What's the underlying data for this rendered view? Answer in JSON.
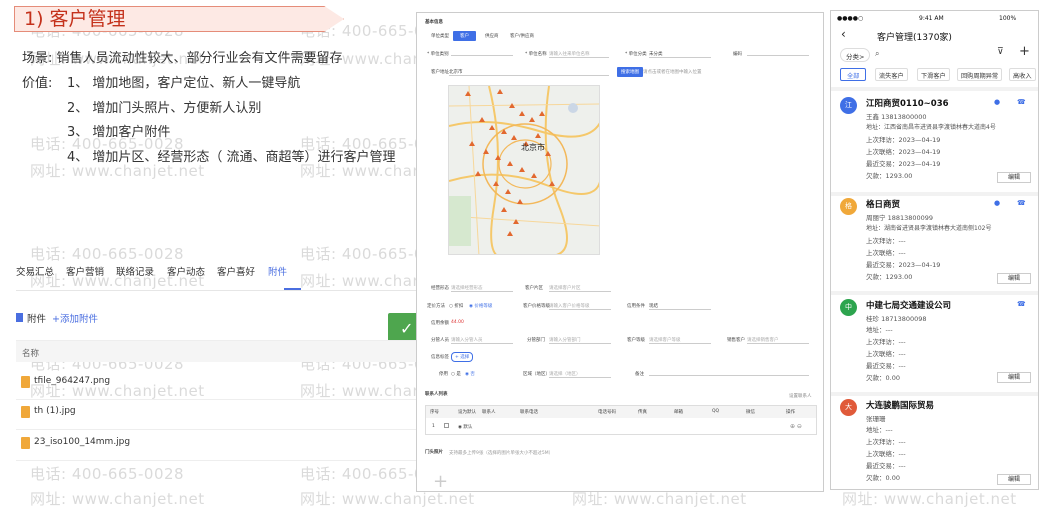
{
  "slide": {
    "title": "1) 客户管理",
    "scene": "场景:   销售人员流动性较大、部分行业会有文件需要留存",
    "value_label": "价值:",
    "values": [
      "1、 增加地图，客户定位、新人一键导航",
      "2、 增加门头照片、方便新人认别",
      "3、 增加客户附件",
      "4、 增加片区、经营形态（ 流通、商超等）进行客户管理"
    ]
  },
  "watermark": {
    "phone": "电话: 400-665-0028",
    "site": "网址: www.chanjet.net"
  },
  "detail": {
    "tabs": [
      "交易汇总",
      "客户营销",
      "联络记录",
      "客户动态",
      "客户喜好",
      "附件"
    ],
    "active_tab": "附件",
    "attach_title": "附件",
    "attach_add": "+添加附件",
    "col_name": "名称",
    "files": [
      "tfile_964247.png",
      "th (1).jpg",
      "23_iso100_14mm.jpg"
    ],
    "confirm_icon": "check-icon"
  },
  "form": {
    "header": "基本信息",
    "tabs": [
      "单位类型",
      "客户",
      "供应商",
      "客户/供应商"
    ],
    "fields": {
      "category": "* 单位类别",
      "name": "* 单位名称",
      "name_ph": "请输入往来单位名称",
      "cat_sub": "* 单位分类",
      "cat_sub_val": "未分类",
      "code": "编码",
      "address": "客户地址",
      "address_val": "北京市",
      "locate_btn": "搜索地图",
      "locate_hint": "请点击或者在地图中输入位置",
      "manager": "经营形态",
      "manager_ph": "请选择经营形态",
      "area": "客户片区",
      "area_ph": "请选择客户片区",
      "settle": "定价方法",
      "settle_opt1": "折扣",
      "settle_opt2": "价格等级",
      "price_level": "客户价格等级",
      "price_ph": "请输入客户价格等级",
      "credit": "信用条件",
      "credit_val": "现结",
      "credit_amt": "信用余额",
      "credit_amt_val": "44.00",
      "owner": "分管人员",
      "owner_ph": "请输入分管人员",
      "dept": "分管部门",
      "dept_ph": "请输入分管部门",
      "level": "客户等级",
      "level_ph": "请选择客户等级",
      "source": "销售客户",
      "source_ph": "请选择销售客户",
      "tag_label": "信息标签",
      "tag_add": "+ 选择",
      "yn_label": "停用",
      "yes": "是",
      "no": "否",
      "region": "区域（地区）",
      "region_ph": "请选择（地区）",
      "remark": "备注",
      "contacts": "联系人列表",
      "contacts_link": "设置联系人",
      "photo": "门头照片",
      "photo_hint": "支持最多上传9张（选择的图片单张大小不超过5M）"
    },
    "table_head": [
      "序号",
      "",
      "设为默认",
      "联系人",
      "联系电话",
      "电话号码",
      "传真",
      "邮箱",
      "QQ",
      "微信",
      "操作"
    ],
    "table_row": [
      "1",
      "",
      "默认"
    ],
    "map_city": "北京市"
  },
  "phone": {
    "time": "9:41 AM",
    "battery": "100%",
    "carrier": "●●●●○",
    "title": "客户管理(1370家)",
    "cat": "分类>",
    "chips": [
      "全部",
      "流失客户",
      "下滑客户",
      "回购周期异常",
      "高收入"
    ],
    "customers": [
      {
        "avatar": "江",
        "name": "江阳商贸0110~036",
        "contact": "王鑫 13813800000",
        "addr": "地址：江西省南昌市进贤县李渡镇林春大道南4号",
        "last_visit": "上次拜访：2023—04-19",
        "last_contact": "上次联络：2023—04-19",
        "last_deal": "最近交易：2023—04-19",
        "debt": "欠款：1293.00",
        "edit": "编辑",
        "color": "#3f6fe6"
      },
      {
        "avatar": "格",
        "name": "格日商贸",
        "contact": "周丽宁 18813800099",
        "addr": "地址：湖南省进贤县李渡镇林春大道南侧102号",
        "last_visit": "上次拜访：---",
        "last_contact": "上次联络：---",
        "last_deal": "最近交易：2023—04-19",
        "debt": "欠款：1293.00",
        "edit": "编辑",
        "color": "#f0a83a"
      },
      {
        "avatar": "中",
        "name": "中建七局交通建设公司",
        "contact": "桂珍 18713800098",
        "addr": "地址：---",
        "last_visit": "上次拜访：---",
        "last_contact": "上次联络：---",
        "last_deal": "最近交易：---",
        "debt": "欠款：0.00",
        "edit": "编辑",
        "color": "#2da44e"
      },
      {
        "avatar": "大",
        "name": "大连骏鹏国际贸易",
        "contact": "张珊珊",
        "addr": "地址：---",
        "last_visit": "上次拜访：---",
        "last_contact": "上次联络：---",
        "last_deal": "最近交易：---",
        "debt": "欠款：0.00",
        "edit": "编辑",
        "color": "#e05a3a"
      }
    ]
  }
}
